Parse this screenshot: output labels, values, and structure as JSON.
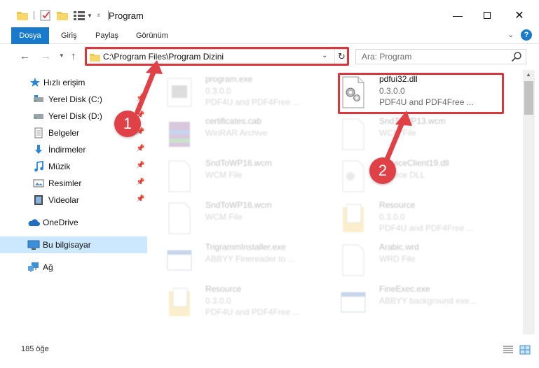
{
  "window": {
    "title": "Program",
    "minimize_icon": "minimize-icon",
    "maximize_icon": "maximize-icon",
    "close_icon": "close-icon"
  },
  "ribbon": {
    "tabs": [
      "Dosya",
      "Giriş",
      "Paylaş",
      "Görünüm"
    ],
    "help_label": "?"
  },
  "address": {
    "path": "C:\\Program Files\\Program Dizini",
    "search_placeholder": "Ara: Program"
  },
  "sidebar": {
    "items": [
      {
        "label": "Hızlı erişim",
        "icon": "star-icon"
      },
      {
        "label": "Yerel Disk (C:)",
        "icon": "drive-icon"
      },
      {
        "label": "Yerel Disk (D:)",
        "icon": "drive-icon"
      },
      {
        "label": "Belgeler",
        "icon": "documents-icon"
      },
      {
        "label": "İndirmeler",
        "icon": "download-icon"
      },
      {
        "label": "Müzik",
        "icon": "music-icon"
      },
      {
        "label": "Resimler",
        "icon": "pictures-icon"
      },
      {
        "label": "Videolar",
        "icon": "videos-icon"
      },
      {
        "label": "OneDrive",
        "icon": "cloud-icon"
      },
      {
        "label": "Bu bilgisayar",
        "icon": "computer-icon"
      },
      {
        "label": "Ağ",
        "icon": "network-icon"
      }
    ]
  },
  "files": [
    {
      "name": "program.exe",
      "line1": "0.3.0.0",
      "line2": "PDF4U and PDF4Free ...",
      "icon": "exe-icon"
    },
    {
      "name": "pdfui32.dll",
      "line1": "0.3.0.0",
      "line2": "PDF4U and PDF4Free ...",
      "icon": "dll-gear-icon"
    },
    {
      "name": "certificates.cab",
      "line1": "WinRAR Archive",
      "line2": "",
      "icon": "archive-icon"
    },
    {
      "name": "SndToWP13.wcm",
      "line1": "WCM File",
      "line2": "",
      "icon": "file-icon"
    },
    {
      "name": "SndToWP16.wcm",
      "line1": "WCM File",
      "line2": "",
      "icon": "file-icon"
    },
    {
      "name": "ServiceClient19.dll",
      "line1": "Service DLL",
      "line2": "",
      "icon": "dll-gear-icon"
    },
    {
      "name": "SndToWP16.wcm",
      "line1": "WCM File",
      "line2": "",
      "icon": "file-icon"
    },
    {
      "name": "Resource",
      "line1": "0.3.0.0",
      "line2": "PDF4U and PDF4Free ...",
      "icon": "folder-doc-icon"
    },
    {
      "name": "TrigrammInstaller.exe",
      "line1": "ABBYY Finereader to ...",
      "line2": "",
      "icon": "app-window-icon"
    },
    {
      "name": "Arabic.wrd",
      "line1": "WRD File",
      "line2": "",
      "icon": "file-icon"
    },
    {
      "name": "Resource",
      "line1": "0.3.0.0",
      "line2": "PDF4U and PDF4Free ...",
      "icon": "folder-doc-icon"
    },
    {
      "name": "FineExec.exe",
      "line1": "ABBYY background exe...",
      "line2": "",
      "icon": "app-window-icon"
    }
  ],
  "status": {
    "count": "185 öğe"
  },
  "callouts": [
    "1",
    "2"
  ],
  "colors": {
    "accent": "#1979ca",
    "highlight": "#d9363e",
    "selected": "#cce8ff"
  }
}
